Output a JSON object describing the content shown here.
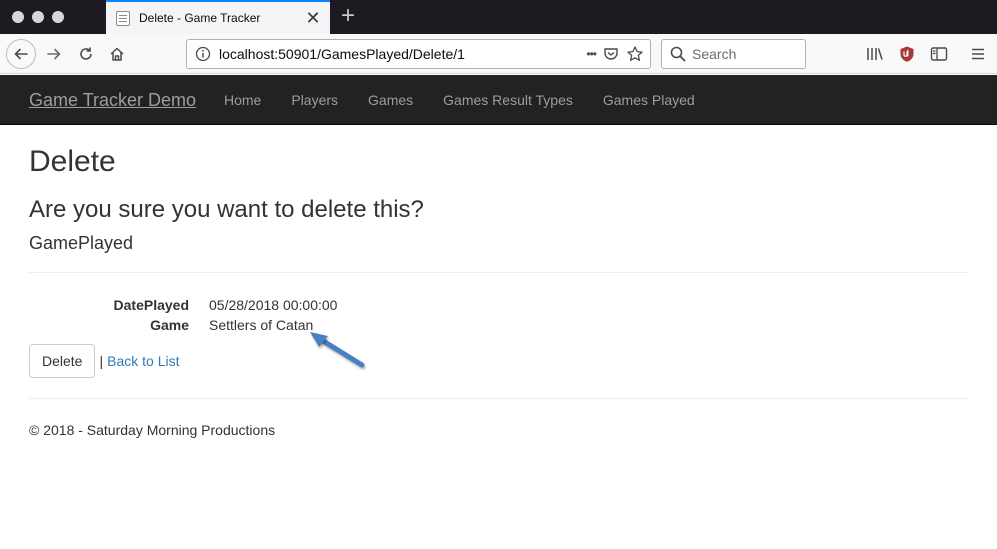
{
  "browser": {
    "tab_title": "Delete - Game Tracker",
    "tab_close": "✕",
    "new_tab": "+",
    "url": "localhost:50901/GamesPlayed/Delete/1",
    "url_more": "•••",
    "search_placeholder": "Search"
  },
  "site": {
    "brand": "Game Tracker Demo",
    "nav": [
      "Home",
      "Players",
      "Games",
      "Games Result Types",
      "Games Played"
    ]
  },
  "page": {
    "title": "Delete",
    "question": "Are you sure you want to delete this?",
    "entity": "GamePlayed",
    "fields": [
      {
        "label": "DatePlayed",
        "value": "05/28/2018 00:00:00"
      },
      {
        "label": "Game",
        "value": "Settlers of Catan"
      }
    ],
    "delete_label": "Delete",
    "separator": "|",
    "back_label": "Back to List",
    "footer": "© 2018 - Saturday Morning Productions"
  },
  "colors": {
    "annotation_arrow": "#4a7fc1",
    "link": "#337ab7",
    "navbar": "#222222",
    "tab_accent": "#0a84ff"
  }
}
